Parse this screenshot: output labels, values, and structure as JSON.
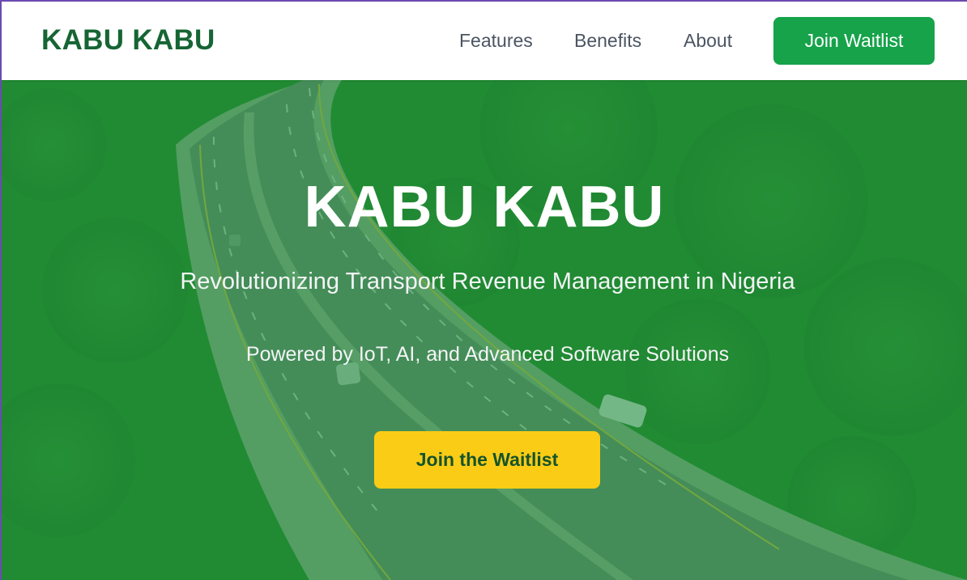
{
  "header": {
    "brand": "KABU KABU",
    "nav": {
      "features": "Features",
      "benefits": "Benefits",
      "about": "About"
    },
    "cta": "Join Waitlist"
  },
  "hero": {
    "title": "KABU KABU",
    "subtitle": "Revolutionizing Transport Revenue Management in Nigeria",
    "tagline": "Powered by IoT, AI, and Advanced Software Solutions",
    "cta": "Join the Waitlist"
  },
  "colors": {
    "brand_green": "#166534",
    "button_green": "#16a34a",
    "cta_yellow": "#facc15",
    "nav_text": "#4b5563"
  }
}
